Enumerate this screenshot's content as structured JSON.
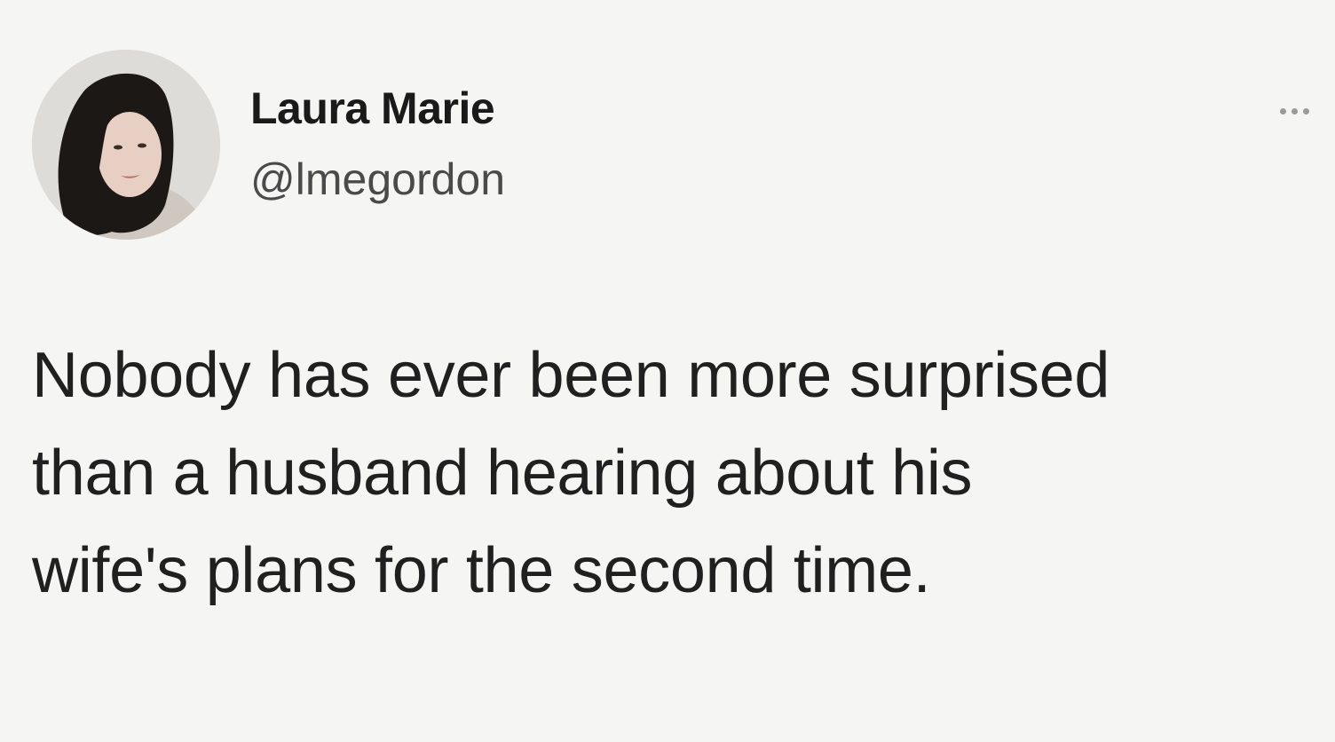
{
  "tweet": {
    "author": {
      "display_name": "Laura Marie",
      "handle": "@lmegordon",
      "avatar_icon": "profile-photo"
    },
    "more_icon": "more-options-icon",
    "text_lines": [
      "Nobody has ever been more surprised",
      "than a husband hearing about his",
      "wife's plans for the second time."
    ]
  },
  "colors": {
    "background": "#f5f5f4",
    "name_text": "#1a1a1a",
    "handle_text": "#4a4a4a",
    "body_text": "#202020"
  }
}
